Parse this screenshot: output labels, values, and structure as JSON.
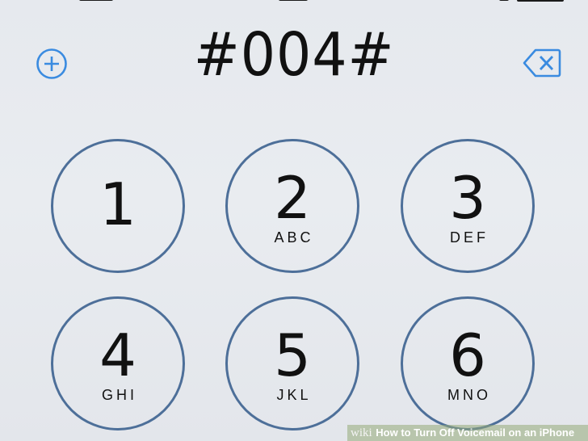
{
  "dialer": {
    "dialed_number": "#004#"
  },
  "keypad": {
    "keys": [
      {
        "digit": "1",
        "letters": ""
      },
      {
        "digit": "2",
        "letters": "ABC"
      },
      {
        "digit": "3",
        "letters": "DEF"
      },
      {
        "digit": "4",
        "letters": "GHI"
      },
      {
        "digit": "5",
        "letters": "JKL"
      },
      {
        "digit": "6",
        "letters": "MNO"
      }
    ]
  },
  "icons": {
    "add_contact": "plus-circle-icon",
    "delete": "backspace-icon"
  },
  "colors": {
    "key_border": "#4d6f99",
    "accent": "#3a8be0",
    "text": "#111111",
    "background": "#e7eaef"
  },
  "watermark": {
    "brand": "wiki",
    "title": "How to Turn Off Voicemail on an iPhone"
  }
}
